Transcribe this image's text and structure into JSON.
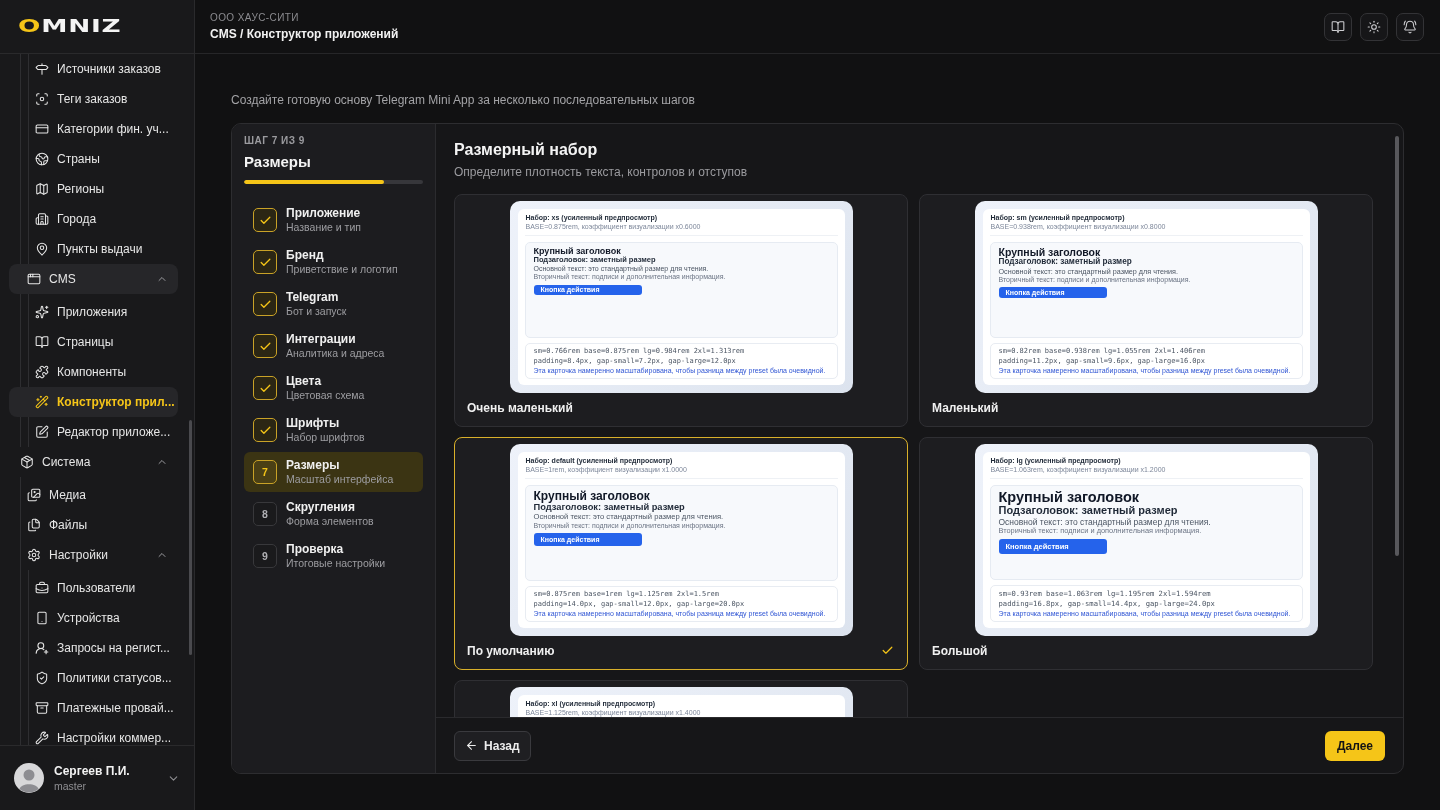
{
  "header": {
    "company": "ООО ХАУС-СИТИ",
    "breadcrumb": "CMS / Конструктор приложений"
  },
  "sidebar": {
    "logo": "OMNIZ",
    "nav": [
      {
        "children": [
          {
            "children": [
              {
                "label": "Источники заказов",
                "selected": false
              },
              {
                "label": "Теги заказов",
                "selected": false
              },
              {
                "label": "Категории фин. уч...",
                "selected": false
              },
              {
                "label": "Страны",
                "selected": false
              },
              {
                "label": "Регионы",
                "selected": false
              },
              {
                "label": "Города",
                "selected": false
              },
              {
                "label": "Пункты выдачи",
                "selected": false
              }
            ]
          },
          {
            "label": "CMS",
            "expanded": true,
            "children": [
              {
                "label": "Приложения",
                "selected": false
              },
              {
                "label": "Страницы",
                "selected": false
              },
              {
                "label": "Компоненты",
                "selected": false
              },
              {
                "label": "Конструктор прил...",
                "selected": true
              },
              {
                "label": "Редактор приложе...",
                "selected": false
              }
            ]
          }
        ]
      },
      {
        "label": "Система",
        "expanded": true,
        "children": [
          {
            "label": "Медиа",
            "selected": false
          },
          {
            "label": "Файлы",
            "selected": false
          },
          {
            "label": "Настройки",
            "expanded": true,
            "children": [
              {
                "label": "Пользователи",
                "selected": false
              },
              {
                "label": "Устройства",
                "selected": false
              },
              {
                "label": "Запросы на регист...",
                "selected": false
              },
              {
                "label": "Политики статусов...",
                "selected": false
              },
              {
                "label": "Платежные провай...",
                "selected": false
              },
              {
                "label": "Настройки коммер...",
                "selected": false
              }
            ]
          }
        ]
      }
    ],
    "user": {
      "name": "Сергеев П.И.",
      "role": "master"
    }
  },
  "intro": "Создайте готовую основу Telegram Mini App за несколько последовательных шагов",
  "wizard": {
    "step_label": "ШАГ 7 ИЗ 9",
    "step_title": "Размеры",
    "progress": {
      "level": 0.78
    },
    "steps": [
      {
        "title": "Приложение",
        "subtitle": "Название и тип",
        "done": true,
        "selected": false
      },
      {
        "title": "Бренд",
        "subtitle": "Приветствие и логотип",
        "done": true,
        "selected": false
      },
      {
        "title": "Telegram",
        "subtitle": "Бот и запуск",
        "done": true,
        "selected": false
      },
      {
        "title": "Интеграции",
        "subtitle": "Аналитика и адреса",
        "done": true,
        "selected": false
      },
      {
        "title": "Цвета",
        "subtitle": "Цветовая схема",
        "done": true,
        "selected": false
      },
      {
        "title": "Шрифты",
        "subtitle": "Набор шрифтов",
        "done": true,
        "selected": false
      },
      {
        "title": "Размеры",
        "subtitle": "Масштаб интерфейса",
        "number": "7",
        "done": false,
        "selected": true
      },
      {
        "title": "Скругления",
        "subtitle": "Форма элементов",
        "number": "8",
        "done": false,
        "selected": false
      },
      {
        "title": "Проверка",
        "subtitle": "Итоговые настройки",
        "number": "9",
        "done": false,
        "selected": false
      }
    ]
  },
  "section": {
    "title": "Размерный набор",
    "subtitle": "Определите плотность текста, контролов и отступов"
  },
  "size_options": [
    {
      "kind": "xs",
      "label": "Очень маленький",
      "selected": false,
      "preview": {
        "title": "Набор: xs (усиленный предпросмотр)",
        "meta": "BASE=0.875rem, коэффициент визуализации x0.6000",
        "heading": "Крупный заголовок",
        "subheading": "Подзаголовок: заметный размер",
        "body": "Основной текст: это стандартный размер для чтения.",
        "secondary": "Вторичный текст: подписи и дополнительная информация.",
        "button": "Кнопка действия",
        "code_lines": [
          "sm=0.766rem base=0.875rem lg=0.984rem 2xl=1.313rem",
          "padding=8.4px, gap-small=7.2px, gap-large=12.0px"
        ],
        "note": "Эта карточка намеренно масштабирована, чтобы разница между preset была очевидной."
      }
    },
    {
      "kind": "sm",
      "label": "Маленький",
      "selected": false,
      "preview": {
        "title": "Набор: sm (усиленный предпросмотр)",
        "meta": "BASE=0.938rem, коэффициент визуализации x0.8000",
        "heading": "Крупный заголовок",
        "subheading": "Подзаголовок: заметный размер",
        "body": "Основной текст: это стандартный размер для чтения.",
        "secondary": "Вторичный текст: подписи и дополнительная информация.",
        "button": "Кнопка действия",
        "code_lines": [
          "sm=0.82rem base=0.938rem lg=1.055rem 2xl=1.406rem",
          "padding=11.2px, gap-small=9.6px, gap-large=16.0px"
        ],
        "note": "Эта карточка намеренно масштабирована, чтобы разница между preset была очевидной."
      }
    },
    {
      "kind": "default",
      "label": "По умолчанию",
      "selected": true,
      "preview": {
        "title": "Набор: default (усиленный предпросмотр)",
        "meta": "BASE=1rem, коэффициент визуализации x1.0000",
        "heading": "Крупный заголовок",
        "subheading": "Подзаголовок: заметный размер",
        "body": "Основной текст: это стандартный размер для чтения.",
        "secondary": "Вторичный текст: подписи и дополнительная информация.",
        "button": "Кнопка действия",
        "code_lines": [
          "sm=0.875rem base=1rem lg=1.125rem 2xl=1.5rem",
          "padding=14.0px, gap-small=12.0px, gap-large=20.0px"
        ],
        "note": "Эта карточка намеренно масштабирована, чтобы разница между preset была очевидной."
      }
    },
    {
      "kind": "lg",
      "label": "Большой",
      "selected": false,
      "preview": {
        "title": "Набор: lg (усиленный предпросмотр)",
        "meta": "BASE=1.063rem, коэффициент визуализации x1.2000",
        "heading": "Крупный заголовок",
        "subheading": "Подзаголовок: заметный размер",
        "body": "Основной текст: это стандартный размер для чтения.",
        "secondary": "Вторичный текст: подписи и дополнительная информация.",
        "button": "Кнопка действия",
        "code_lines": [
          "sm=0.93rem base=1.063rem lg=1.195rem 2xl=1.594rem",
          "padding=16.8px, gap-small=14.4px, gap-large=24.0px"
        ],
        "note": "Эта карточка намеренно масштабирована, чтобы разница между preset была очевидной."
      }
    },
    {
      "kind": "xl",
      "selected": false,
      "preview": {
        "title": "Набор: xl (усиленный предпросмотр)",
        "meta": "BASE=1.125rem, коэффициент визуализации x1.4000"
      }
    }
  ],
  "footer": {
    "back": "Назад",
    "next": "Далее"
  }
}
